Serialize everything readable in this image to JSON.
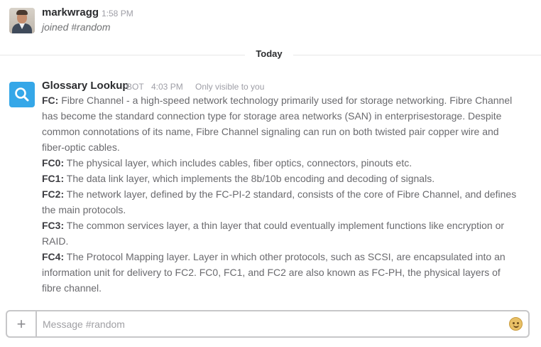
{
  "messages": [
    {
      "author": "markwragg",
      "time": "1:58 PM",
      "text": "joined #random"
    }
  ],
  "divider": {
    "label": "Today"
  },
  "bot_message": {
    "author": "Glossary Lookup",
    "badge": "BOT",
    "time": "4:03 PM",
    "visibility": "Only visible to you",
    "entries": [
      {
        "term": "FC:",
        "definition": " Fibre Channel - a high-speed network technology primarily used for storage networking. Fibre Channel has become the standard connection type for storage area networks (SAN) in enterprisestorage. Despite common connotations of its name, Fibre Channel signaling can run on both twisted pair copper wire and fiber-optic cables."
      },
      {
        "term": "FC0:",
        "definition": " The physical layer, which includes cables, fiber optics, connectors, pinouts etc."
      },
      {
        "term": "FC1:",
        "definition": " The data link layer, which implements the 8b/10b encoding and decoding of signals."
      },
      {
        "term": "FC2:",
        "definition": " The network layer, defined by the FC-PI-2 standard, consists of the core of Fibre Channel, and defines the main protocols."
      },
      {
        "term": "FC3:",
        "definition": " The common services layer, a thin layer that could eventually implement functions like encryption or RAID."
      },
      {
        "term": "FC4:",
        "definition": " The Protocol Mapping layer. Layer in which other protocols, such as SCSI, are encapsulated into an information unit for delivery to FC2. FC0, FC1, and FC2 are also known as FC-PH, the physical layers of fibre channel."
      }
    ]
  },
  "composer": {
    "add_label": "+",
    "placeholder": "Message #random",
    "value": ""
  },
  "icons": {
    "bot_avatar": "search-icon",
    "composer_add": "plus-icon",
    "composer_emoji": "emoji-icon"
  },
  "colors": {
    "bot_avatar_bg": "#35a7e8",
    "body_text": "#6a6a6e",
    "meta_text": "#9e9ea6"
  }
}
